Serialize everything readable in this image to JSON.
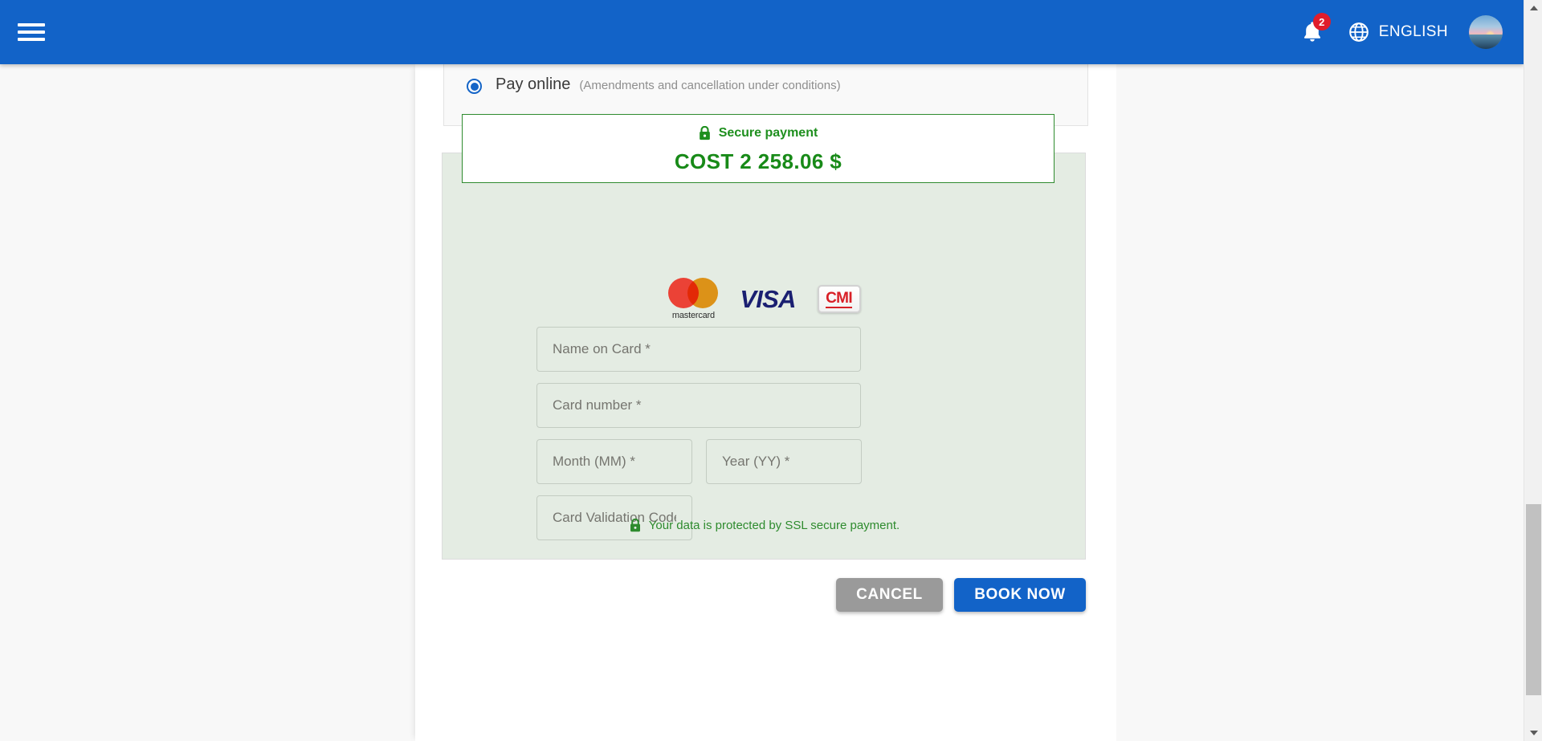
{
  "topbar": {
    "menu_icon": "hamburger-menu-icon",
    "notifications": {
      "icon": "bell-icon",
      "badge_count": "2"
    },
    "language": {
      "icon": "globe-icon",
      "label": "ENGLISH"
    },
    "avatar": {
      "icon": "user-avatar"
    },
    "background_color": "#1263c8"
  },
  "payment_option": {
    "selected": true,
    "title": "Pay online",
    "note": "(Amendments and cancellation under conditions)"
  },
  "cost_box": {
    "lock_icon": "lock-icon",
    "secure_label": "Secure payment",
    "cost_label": "COST  2 258.06 $",
    "border_color": "#2e8b2e",
    "text_color": "#188a18"
  },
  "card_logos": [
    {
      "name": "mastercard-logo",
      "text": "mastercard"
    },
    {
      "name": "visa-logo",
      "text": "VISA"
    },
    {
      "name": "cmi-logo",
      "text": "CMI"
    }
  ],
  "form": {
    "name_on_card": {
      "value": "",
      "placeholder": "Name on Card *"
    },
    "card_number": {
      "value": "",
      "placeholder": "Card number *"
    },
    "month": {
      "value": "",
      "placeholder": "Month (MM) *"
    },
    "year": {
      "value": "",
      "placeholder": "Year (YY) *"
    },
    "cvc": {
      "value": "",
      "placeholder": "Card Validation Code *"
    }
  },
  "ssl_note": {
    "lock_icon": "lock-icon",
    "text": "Your data is protected by SSL secure payment."
  },
  "actions": {
    "cancel_label": "CANCEL",
    "book_label": "BOOK NOW",
    "cancel_color": "#9a9a9a",
    "book_color": "#1263c8"
  },
  "scrollbar": {
    "up_arrow": "scroll-up-arrow",
    "down_arrow": "scroll-down-arrow"
  }
}
